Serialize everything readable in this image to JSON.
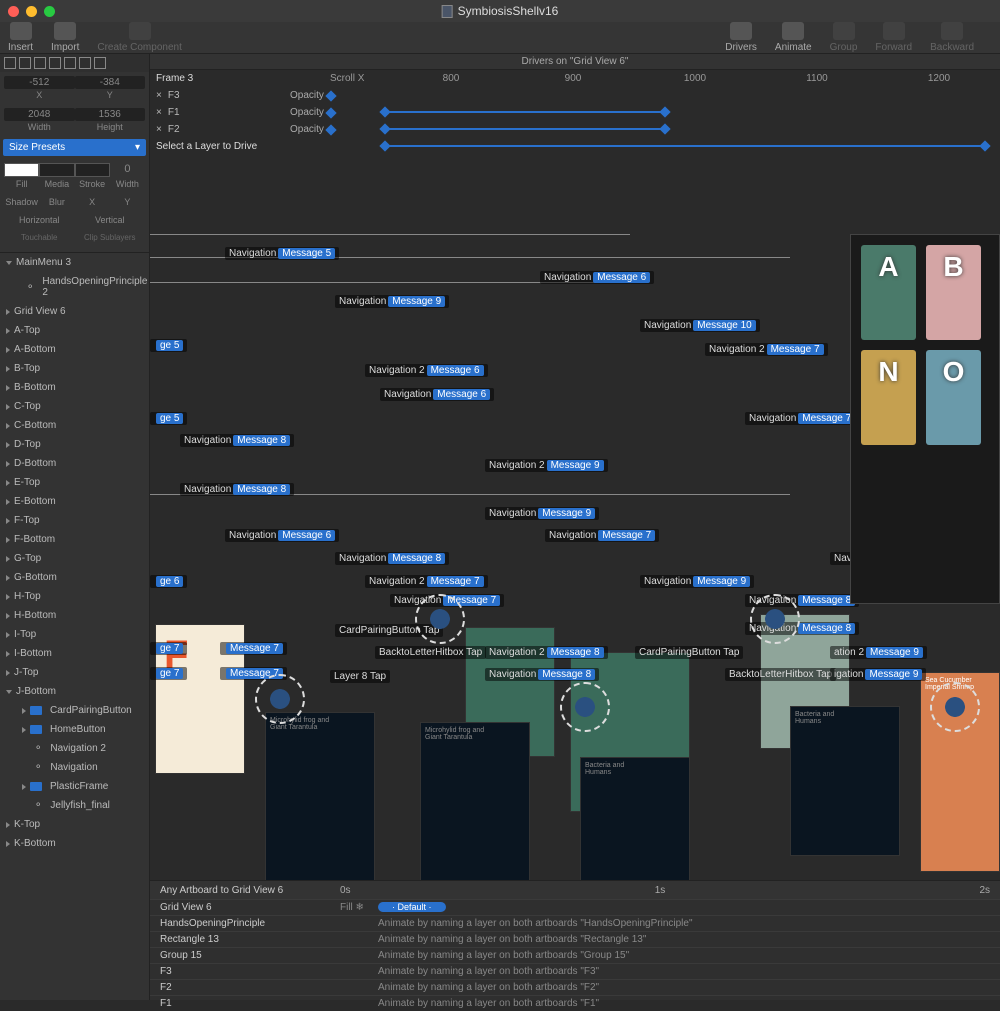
{
  "document_title": "SymbiosisShellv16",
  "toolbar": {
    "insert": "Insert",
    "import": "Import",
    "create_component": "Create Component",
    "drivers": "Drivers",
    "animate": "Animate",
    "group": "Group",
    "forward": "Forward",
    "backward": "Backward"
  },
  "position": {
    "x": "-512",
    "y": "-384",
    "x_label": "X",
    "y_label": "Y"
  },
  "size": {
    "w": "2048",
    "h": "1536",
    "w_label": "Width",
    "h_label": "Height"
  },
  "size_presets": "Size Presets",
  "props": {
    "fill": "Fill",
    "media": "Media",
    "stroke": "Stroke",
    "width": "Width",
    "shadow": "Shadow",
    "blur": "Blur",
    "px": "X",
    "py": "Y",
    "horizontal": "Horizontal",
    "vertical": "Vertical",
    "touchable": "Touchable",
    "clip_sublayers": "Clip Sublayers"
  },
  "layers": [
    {
      "name": "MainMenu 3",
      "open": true,
      "children": [
        {
          "name": "HandsOpeningPrinciple 2"
        }
      ]
    },
    {
      "name": "Grid View 6"
    },
    {
      "name": "A-Top"
    },
    {
      "name": "A-Bottom"
    },
    {
      "name": "B-Top"
    },
    {
      "name": "B-Bottom"
    },
    {
      "name": "C-Top"
    },
    {
      "name": "C-Bottom"
    },
    {
      "name": "D-Top"
    },
    {
      "name": "D-Bottom"
    },
    {
      "name": "E-Top"
    },
    {
      "name": "E-Bottom"
    },
    {
      "name": "F-Top"
    },
    {
      "name": "F-Bottom"
    },
    {
      "name": "G-Top"
    },
    {
      "name": "G-Bottom"
    },
    {
      "name": "H-Top"
    },
    {
      "name": "H-Bottom"
    },
    {
      "name": "I-Top"
    },
    {
      "name": "I-Bottom"
    },
    {
      "name": "J-Top"
    },
    {
      "name": "J-Bottom",
      "open": true,
      "children": [
        {
          "name": "CardPairingButton",
          "folder": true
        },
        {
          "name": "HomeButton",
          "folder": true
        },
        {
          "name": "Navigation 2"
        },
        {
          "name": "Navigation"
        },
        {
          "name": "PlasticFrame",
          "folder": true
        },
        {
          "name": "Jellyfish_final"
        }
      ]
    },
    {
      "name": "K-Top"
    },
    {
      "name": "K-Bottom"
    }
  ],
  "drivers_header": "Drivers on \"Grid View 6\"",
  "driver_label_col": "Frame 3",
  "driver_prop_header": "Scroll X",
  "driver_rows": [
    "F3",
    "F1",
    "F2"
  ],
  "driver_prop": "Opacity",
  "driver_select_hint": "Select a Layer to Drive",
  "ruler_ticks": [
    "800",
    "900",
    "1000",
    "1100",
    "1200"
  ],
  "tags": [
    {
      "t": 193,
      "l": 75,
      "text": "Navigation",
      "msg": "Message 5"
    },
    {
      "t": 217,
      "l": 390,
      "text": "Navigation",
      "msg": "Message 6"
    },
    {
      "t": 241,
      "l": 185,
      "text": "Navigation",
      "msg": "Message 9"
    },
    {
      "t": 265,
      "l": 490,
      "text": "Navigation",
      "msg": "Message 10"
    },
    {
      "t": 285,
      "l": 0,
      "text": "",
      "msg": "ge 5"
    },
    {
      "t": 289,
      "l": 555,
      "text": "Navigation 2",
      "msg": "Message 7"
    },
    {
      "t": 310,
      "l": 215,
      "text": "Navigation 2",
      "msg": "Message 6"
    },
    {
      "t": 334,
      "l": 230,
      "text": "Navigation",
      "msg": "Message 6"
    },
    {
      "t": 358,
      "l": 0,
      "text": "",
      "msg": "ge 5"
    },
    {
      "t": 358,
      "l": 595,
      "text": "Navigation",
      "msg": "Message 7"
    },
    {
      "t": 380,
      "l": 30,
      "text": "Navigation",
      "msg": "Message 8"
    },
    {
      "t": 405,
      "l": 335,
      "text": "Navigation 2",
      "msg": "Message 9"
    },
    {
      "t": 429,
      "l": 30,
      "text": "Navigation",
      "msg": "Message 8"
    },
    {
      "t": 453,
      "l": 335,
      "text": "Navigation",
      "msg": "Message 9"
    },
    {
      "t": 475,
      "l": 75,
      "text": "Navigation",
      "msg": "Message 6"
    },
    {
      "t": 475,
      "l": 395,
      "text": "Navigation",
      "msg": "Message 7"
    },
    {
      "t": 498,
      "l": 185,
      "text": "Navigation",
      "msg": "Message 8"
    },
    {
      "t": 498,
      "l": 680,
      "text": "Navi",
      "msg": ""
    },
    {
      "t": 521,
      "l": 0,
      "text": "",
      "msg": "ge 6"
    },
    {
      "t": 521,
      "l": 215,
      "text": "Navigation 2",
      "msg": "Message 7"
    },
    {
      "t": 521,
      "l": 490,
      "text": "Navigation",
      "msg": "Message 9"
    },
    {
      "t": 540,
      "l": 240,
      "text": "Navigation",
      "msg": "Message 7"
    },
    {
      "t": 540,
      "l": 595,
      "text": "Navigation",
      "msg": "Message 8"
    },
    {
      "t": 568,
      "l": 595,
      "text": "Navigation",
      "msg": "Message 8"
    },
    {
      "t": 570,
      "l": 185,
      "text": "CardPairingButton Tap",
      "msg": ""
    },
    {
      "t": 588,
      "l": 0,
      "text": "",
      "msg": "ge 7"
    },
    {
      "t": 588,
      "l": 70,
      "text": "",
      "msg": "Message 7"
    },
    {
      "t": 592,
      "l": 335,
      "text": "Navigation 2",
      "msg": "Message 8"
    },
    {
      "t": 592,
      "l": 485,
      "text": "CardPairingButton Tap",
      "msg": ""
    },
    {
      "t": 592,
      "l": 680,
      "text": "ation 2",
      "msg": "Message 9"
    },
    {
      "t": 592,
      "l": 225,
      "text": "BacktoLetterHitbox Tap",
      "msg": ""
    },
    {
      "t": 613,
      "l": 0,
      "text": "",
      "msg": "ge 7"
    },
    {
      "t": 613,
      "l": 70,
      "text": "",
      "msg": "Message 7"
    },
    {
      "t": 614,
      "l": 335,
      "text": "Navigation",
      "msg": "Message 8"
    },
    {
      "t": 614,
      "l": 575,
      "text": "BacktoLetterHitbox Tap",
      "msg": ""
    },
    {
      "t": 614,
      "l": 680,
      "text": "igation",
      "msg": "Message 9"
    },
    {
      "t": 616,
      "l": 180,
      "text": "Layer 8 Tap",
      "msg": ""
    }
  ],
  "preview_letters": [
    "A",
    "B",
    "N",
    "O"
  ],
  "timeline": {
    "header_left": "Any Artboard to Grid View 6",
    "time_marks": [
      "0s",
      "1s",
      "2s"
    ],
    "fill_label": "Fill",
    "default_label": "Default",
    "rows": [
      {
        "name": "Grid View 6",
        "fill": true
      },
      {
        "name": "HandsOpeningPrinciple",
        "desc": "Animate by naming a layer on both artboards \"HandsOpeningPrinciple\""
      },
      {
        "name": "Rectangle 13",
        "desc": "Animate by naming a layer on both artboards \"Rectangle 13\""
      },
      {
        "name": "Group 15",
        "desc": "Animate by naming a layer on both artboards \"Group 15\""
      },
      {
        "name": "F3",
        "desc": "Animate by naming a layer on both artboards \"F3\""
      },
      {
        "name": "F2",
        "desc": "Animate by naming a layer on both artboards \"F2\""
      },
      {
        "name": "F1",
        "desc": "Animate by naming a layer on both artboards \"F1\""
      }
    ]
  }
}
